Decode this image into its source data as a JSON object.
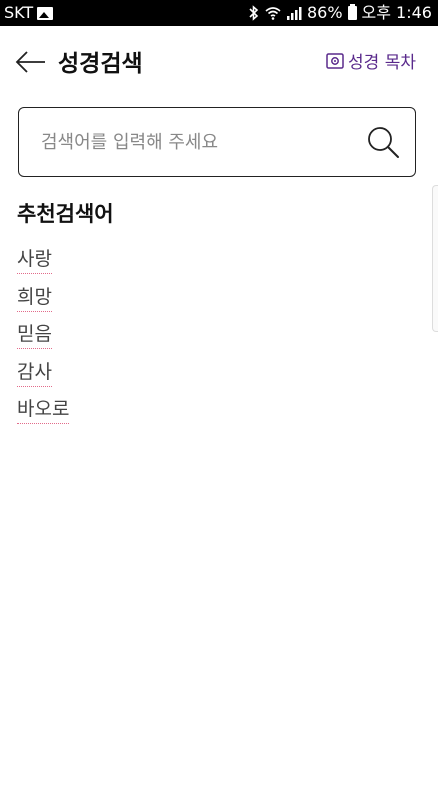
{
  "status_bar": {
    "carrier": "SKT",
    "battery_percent": "86%",
    "time": "오후 1:46",
    "icons": [
      "image-icon",
      "bluetooth-icon",
      "wifi-icon",
      "signal-icon",
      "battery-icon"
    ]
  },
  "header": {
    "title": "성경검색",
    "toc_label": "성경 목차",
    "accent_color": "#5a2a8c"
  },
  "search": {
    "placeholder": "검색어를 입력해 주세요",
    "value": ""
  },
  "recommended": {
    "title": "추천검색어",
    "keywords": [
      "사랑",
      "희망",
      "믿음",
      "감사",
      "바오로"
    ]
  }
}
